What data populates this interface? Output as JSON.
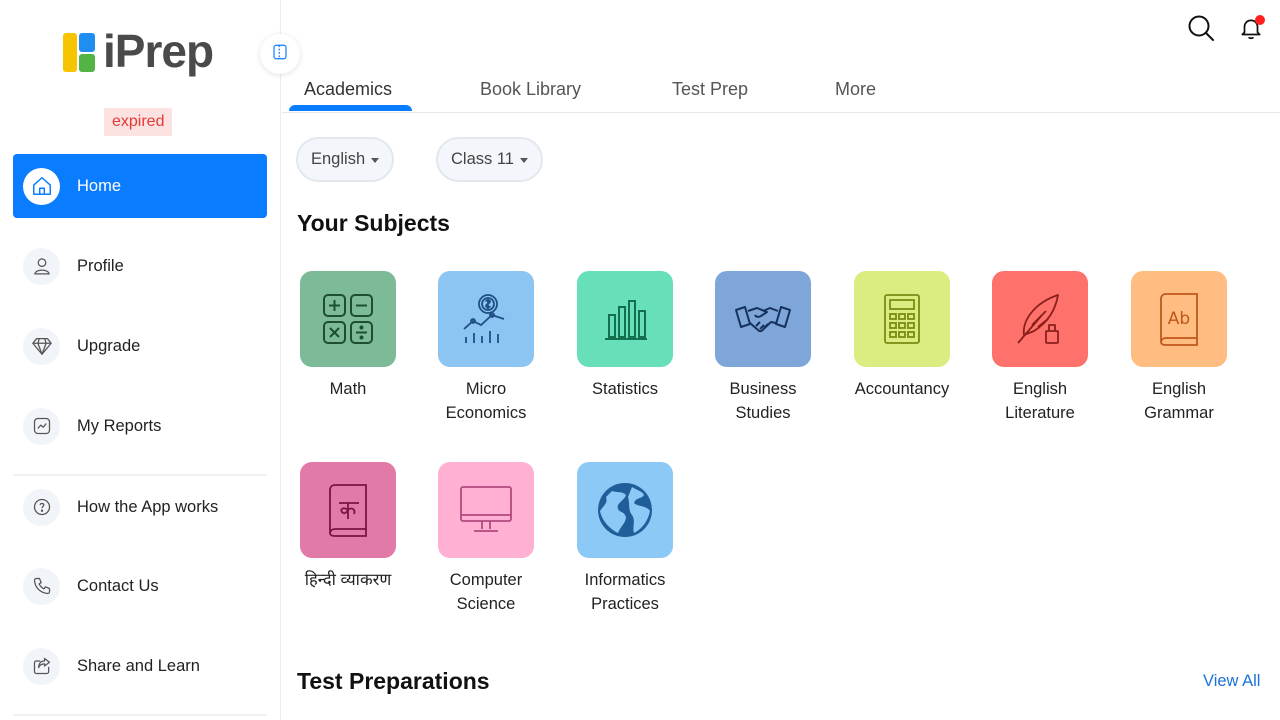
{
  "app": {
    "logo_text": "iPrep",
    "status_badge": "expired"
  },
  "sidebar": {
    "items": [
      {
        "label": "Home",
        "icon": "home-icon",
        "active": true
      },
      {
        "label": "Profile",
        "icon": "user-icon"
      },
      {
        "label": "Upgrade",
        "icon": "diamond-icon"
      },
      {
        "label": "My Reports",
        "icon": "report-icon"
      },
      {
        "label": "How the App works",
        "icon": "help-icon"
      },
      {
        "label": "Contact Us",
        "icon": "phone-icon"
      },
      {
        "label": "Share and Learn",
        "icon": "share-icon"
      }
    ]
  },
  "header": {
    "search_icon": "search-icon",
    "notification_icon": "bell-icon"
  },
  "tabs": [
    {
      "label": "Academics",
      "active": true
    },
    {
      "label": "Book Library"
    },
    {
      "label": "Test Prep"
    },
    {
      "label": "More"
    }
  ],
  "filters": {
    "language": "English",
    "class": "Class 11"
  },
  "subjects_section": {
    "title": "Your Subjects",
    "items": [
      {
        "label": "Math",
        "color": "#7dba97",
        "icon": "calculator-keys-icon"
      },
      {
        "label": "Micro\nEconomics",
        "color": "#8cc4f2",
        "icon": "finance-chart-icon"
      },
      {
        "label": "Statistics",
        "color": "#67dfbb",
        "icon": "bar-chart-icon"
      },
      {
        "label": "Business\nStudies",
        "color": "#7ea6d8",
        "icon": "handshake-icon"
      },
      {
        "label": "Accountancy",
        "color": "#dbec80",
        "icon": "calculator-icon"
      },
      {
        "label": "English\nLiterature",
        "color": "#ff726c",
        "icon": "quill-icon"
      },
      {
        "label": "English\nGrammar",
        "color": "#ffbd82",
        "icon": "book-ab-icon"
      },
      {
        "label": "हिन्दी व्याकरण",
        "color": "#e17aa7",
        "icon": "hindi-book-icon"
      },
      {
        "label": "Computer\nScience",
        "color": "#ffb0d3",
        "icon": "monitor-icon"
      },
      {
        "label": "Informatics\nPractices",
        "color": "#8cc9f6",
        "icon": "globe-icon"
      }
    ]
  },
  "test_section": {
    "title": "Test Preparations",
    "view_all": "View All"
  },
  "colors": {
    "accent": "#0a7cff",
    "link": "#1a73d9",
    "badge_bg": "#fde2e2",
    "badge_text": "#e53935"
  }
}
